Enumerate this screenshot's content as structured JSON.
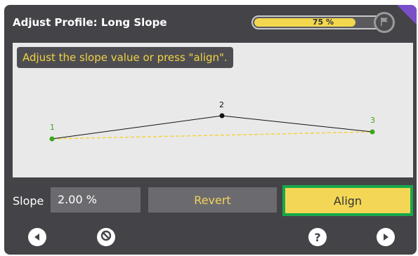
{
  "header": {
    "title": "Adjust Profile: Long Slope",
    "progress_label": "75 %",
    "progress_fraction": 0.75,
    "flag_icon": "flag-icon"
  },
  "canvas": {
    "hint": "Adjust the slope value or press \"align\".",
    "points": [
      {
        "label": "1",
        "color": "#3aa81a"
      },
      {
        "label": "2",
        "color": "#111111"
      },
      {
        "label": "3",
        "color": "#3aa81a"
      }
    ],
    "dashed_color": "#f3d23e"
  },
  "controls": {
    "slope_label": "Slope",
    "slope_value": "2.00 %",
    "revert_label": "Revert",
    "align_label": "Align"
  },
  "footer": {
    "icons": [
      "back-icon",
      "cancel-icon",
      "help-icon",
      "next-icon"
    ]
  },
  "colors": {
    "accent_yellow": "#f3d656",
    "align_border": "#17a84a",
    "corner": "#7b4fc9"
  }
}
